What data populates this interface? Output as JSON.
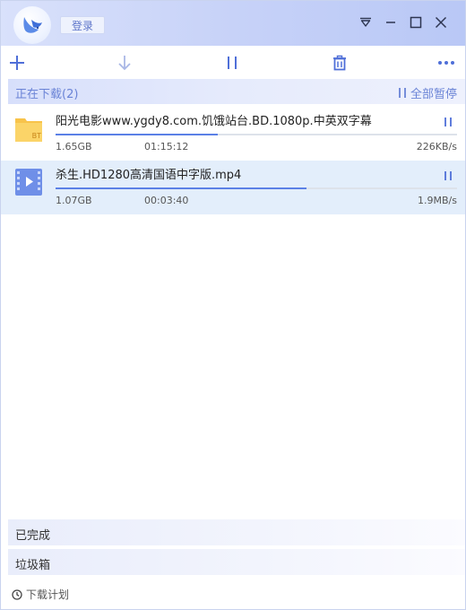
{
  "titlebar": {
    "login_label": "登录"
  },
  "downloading": {
    "title": "正在下载(2)",
    "pause_all_label": "全部暂停",
    "items": [
      {
        "name": "阳光电影www.ygdy8.com.饥饿站台.BD.1080p.中英双字幕",
        "size": "1.65GB",
        "time": "01:15:12",
        "speed": "226KB/s",
        "progress": 0.405,
        "icon": "bt-folder-icon",
        "icon_badge": "BT"
      },
      {
        "name": "杀生.HD1280高清国语中字版.mp4",
        "size": "1.07GB",
        "time": "00:03:40",
        "speed": "1.9MB/s",
        "progress": 0.625,
        "icon": "video-file-icon"
      }
    ]
  },
  "sections": {
    "completed": "已完成",
    "trash": "垃圾箱"
  },
  "footer": {
    "schedule_label": "下载计划"
  },
  "colors": {
    "accent": "#5b80e6",
    "section_text": "#6a83d6",
    "selected_row": "#e3eefb"
  }
}
